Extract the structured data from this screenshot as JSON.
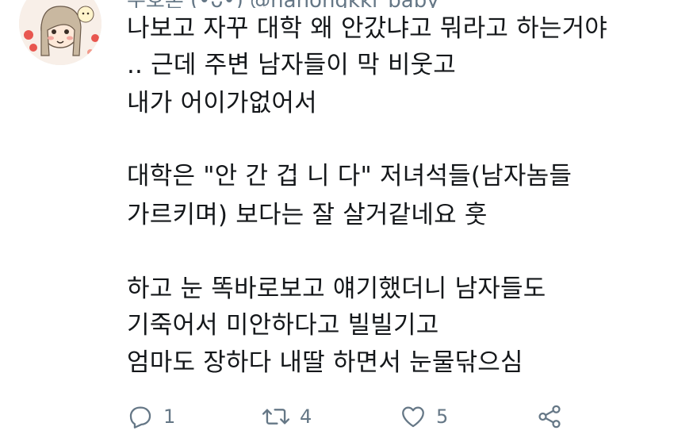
{
  "tweet": {
    "header_text": "수호혼 (•ᴗ•) @nahongkki_baby",
    "lines": [
      "나보고 자꾸 대학 왜 안갔냐고 뭐라고 하는거야",
      ".. 근데 주변 남자들이 막 비웃고",
      "내가 어이가없어서",
      "대학은 \"안 간 겁 니 다\" 저녀석들(남자놈들",
      "가르키며) 보다는 잘 살거같네요 훗",
      "하고 눈 똑바로보고 얘기했더니 남자들도",
      "기죽어서 미안하다고 빌빌기고",
      "엄마도 장하다 내딸 하면서 눈물닦으심"
    ]
  },
  "actions": {
    "reply": {
      "icon": "reply-icon",
      "count": "1"
    },
    "retweet": {
      "icon": "retweet-icon",
      "count": "4"
    },
    "like": {
      "icon": "heart-icon",
      "count": "5"
    },
    "share": {
      "icon": "share-icon"
    }
  },
  "colors": {
    "text": "#14171a",
    "secondary": "#657786",
    "background": "#ffffff"
  }
}
